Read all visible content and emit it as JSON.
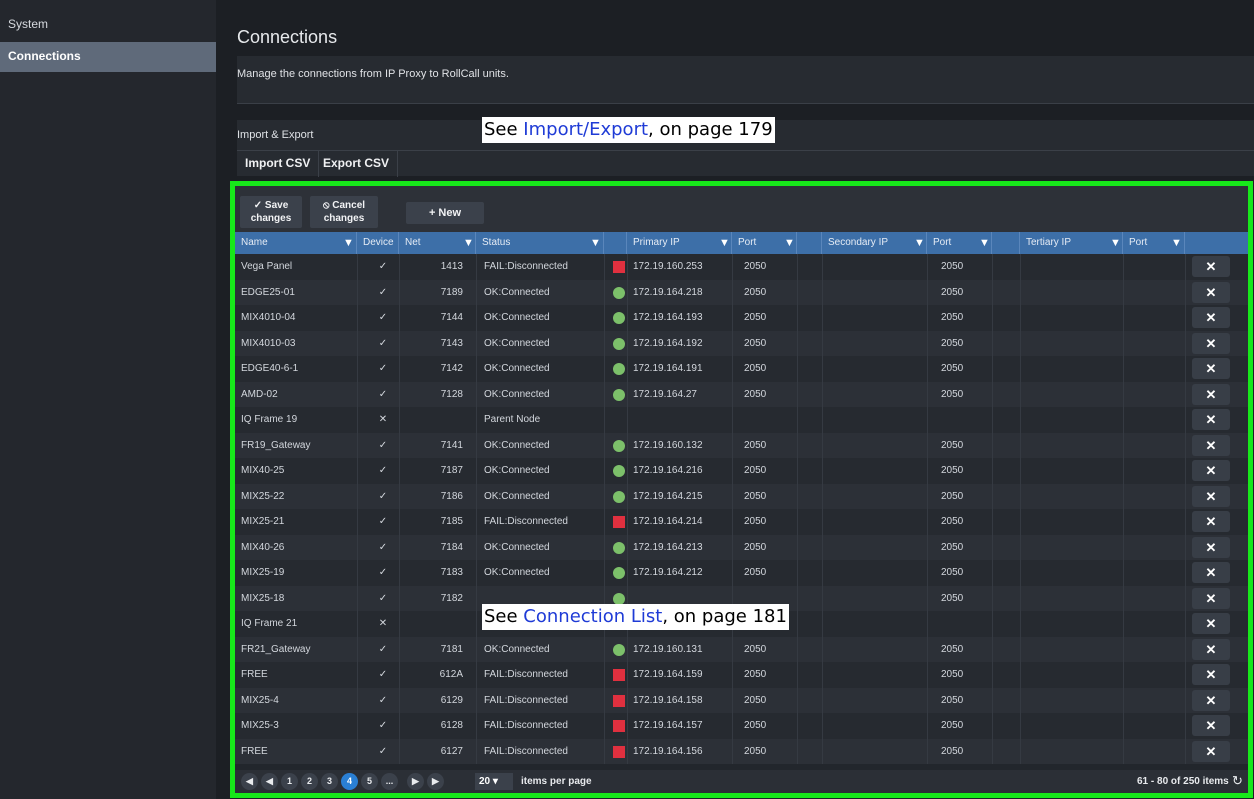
{
  "sidebar": {
    "items": [
      {
        "label": "System"
      },
      {
        "label": "Connections"
      }
    ]
  },
  "page": {
    "title": "Connections",
    "description": "Manage the connections from IP Proxy to RollCall units."
  },
  "import_export": {
    "title": "Import & Export",
    "import_label": "Import CSV",
    "export_label": "Export CSV"
  },
  "callouts": {
    "top": {
      "prefix": "See ",
      "link": "Import/Export",
      "suffix": ", on page 179"
    },
    "middle": {
      "prefix": "See ",
      "link": "Connection List",
      "suffix": ", on page 181"
    }
  },
  "toolbar": {
    "save_line1": "Save",
    "save_line2": "changes",
    "cancel_line1": "Cancel",
    "cancel_line2": "changes",
    "new_label": "New"
  },
  "columns": {
    "name": "Name",
    "device": "Device",
    "net": "Net",
    "status": "Status",
    "primary_ip": "Primary IP",
    "port1": "Port",
    "secondary_ip": "Secondary IP",
    "port2": "Port",
    "tertiary_ip": "Tertiary IP",
    "port3": "Port"
  },
  "rows": [
    {
      "name": "Vega Panel",
      "device": "✓",
      "net": "1413",
      "status": "FAIL:Disconnected",
      "state": "fail",
      "primary_ip": "172.19.160.253",
      "port": "2050",
      "sport": "2050"
    },
    {
      "name": "EDGE25-01",
      "device": "✓",
      "net": "7189",
      "status": "OK:Connected",
      "state": "ok",
      "primary_ip": "172.19.164.218",
      "port": "2050",
      "sport": "2050"
    },
    {
      "name": "MIX4010-04",
      "device": "✓",
      "net": "7144",
      "status": "OK:Connected",
      "state": "ok",
      "primary_ip": "172.19.164.193",
      "port": "2050",
      "sport": "2050"
    },
    {
      "name": "MIX4010-03",
      "device": "✓",
      "net": "7143",
      "status": "OK:Connected",
      "state": "ok",
      "primary_ip": "172.19.164.192",
      "port": "2050",
      "sport": "2050"
    },
    {
      "name": "EDGE40-6-1",
      "device": "✓",
      "net": "7142",
      "status": "OK:Connected",
      "state": "ok",
      "primary_ip": "172.19.164.191",
      "port": "2050",
      "sport": "2050"
    },
    {
      "name": "AMD-02",
      "device": "✓",
      "net": "7128",
      "status": "OK:Connected",
      "state": "ok",
      "primary_ip": "172.19.164.27",
      "port": "2050",
      "sport": "2050"
    },
    {
      "name": "IQ Frame 19",
      "device": "✕",
      "net": "",
      "status": "Parent Node",
      "state": "none",
      "primary_ip": "",
      "port": "",
      "sport": ""
    },
    {
      "name": "FR19_Gateway",
      "device": "✓",
      "net": "7141",
      "status": "OK:Connected",
      "state": "ok",
      "primary_ip": "172.19.160.132",
      "port": "2050",
      "sport": "2050"
    },
    {
      "name": "MIX40-25",
      "device": "✓",
      "net": "7187",
      "status": "OK:Connected",
      "state": "ok",
      "primary_ip": "172.19.164.216",
      "port": "2050",
      "sport": "2050"
    },
    {
      "name": "MIX25-22",
      "device": "✓",
      "net": "7186",
      "status": "OK:Connected",
      "state": "ok",
      "primary_ip": "172.19.164.215",
      "port": "2050",
      "sport": "2050"
    },
    {
      "name": "MIX25-21",
      "device": "✓",
      "net": "7185",
      "status": "FAIL:Disconnected",
      "state": "fail",
      "primary_ip": "172.19.164.214",
      "port": "2050",
      "sport": "2050"
    },
    {
      "name": "MIX40-26",
      "device": "✓",
      "net": "7184",
      "status": "OK:Connected",
      "state": "ok",
      "primary_ip": "172.19.164.213",
      "port": "2050",
      "sport": "2050"
    },
    {
      "name": "MIX25-19",
      "device": "✓",
      "net": "7183",
      "status": "OK:Connected",
      "state": "ok",
      "primary_ip": "172.19.164.212",
      "port": "2050",
      "sport": "2050"
    },
    {
      "name": "MIX25-18",
      "device": "✓",
      "net": "7182",
      "status": "",
      "state": "ok",
      "primary_ip": "",
      "port": "",
      "sport": "2050"
    },
    {
      "name": "IQ Frame 21",
      "device": "✕",
      "net": "",
      "status": "",
      "state": "none",
      "primary_ip": "",
      "port": "",
      "sport": ""
    },
    {
      "name": "FR21_Gateway",
      "device": "✓",
      "net": "7181",
      "status": "OK:Connected",
      "state": "ok",
      "primary_ip": "172.19.160.131",
      "port": "2050",
      "sport": "2050"
    },
    {
      "name": "FREE",
      "device": "✓",
      "net": "612A",
      "status": "FAIL:Disconnected",
      "state": "fail",
      "primary_ip": "172.19.164.159",
      "port": "2050",
      "sport": "2050"
    },
    {
      "name": "MIX25-4",
      "device": "✓",
      "net": "6129",
      "status": "FAIL:Disconnected",
      "state": "fail",
      "primary_ip": "172.19.164.158",
      "port": "2050",
      "sport": "2050"
    },
    {
      "name": "MIX25-3",
      "device": "✓",
      "net": "6128",
      "status": "FAIL:Disconnected",
      "state": "fail",
      "primary_ip": "172.19.164.157",
      "port": "2050",
      "sport": "2050"
    },
    {
      "name": "FREE",
      "device": "✓",
      "net": "6127",
      "status": "FAIL:Disconnected",
      "state": "fail",
      "primary_ip": "172.19.164.156",
      "port": "2050",
      "sport": "2050"
    }
  ],
  "delete_glyph": "✕",
  "pager": {
    "first": "◀",
    "prev": "◀",
    "pages": [
      "1",
      "2",
      "3",
      "4",
      "5",
      "..."
    ],
    "current": "4",
    "next": "▶",
    "last": "▶",
    "per_page": "20",
    "per_page_label": "items per page",
    "info": "61 - 80 of 250 items"
  },
  "colors": {
    "ok": "#7cc06a",
    "fail": "#e0303f",
    "header": "#3d6fa8",
    "frame": "#17e81a"
  }
}
